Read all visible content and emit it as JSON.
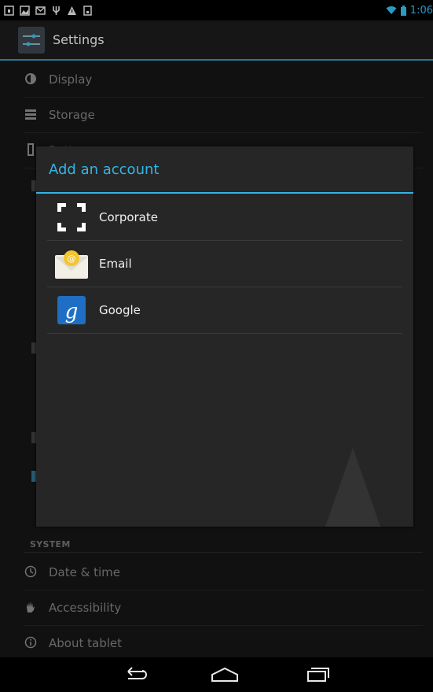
{
  "status_bar": {
    "time": "1:06",
    "left_icons": [
      "tablet-icon",
      "image-icon",
      "mail-icon",
      "usb-icon",
      "warning-icon",
      "download-icon"
    ],
    "right_icons": [
      "wifi-icon",
      "battery-icon"
    ],
    "accent_color": "#33b5e5"
  },
  "action_bar": {
    "title": "Settings",
    "icon": "settings-sliders-icon"
  },
  "settings": {
    "items": [
      {
        "label": "Display",
        "icon": "brightness-icon"
      },
      {
        "label": "Storage",
        "icon": "storage-icon"
      },
      {
        "label": "Battery",
        "icon": "battery-icon"
      }
    ],
    "system_header": "SYSTEM",
    "system_items": [
      {
        "label": "Date & time",
        "icon": "clock-icon"
      },
      {
        "label": "Accessibility",
        "icon": "hand-icon"
      },
      {
        "label": "About tablet",
        "icon": "info-icon"
      }
    ]
  },
  "dialog": {
    "title": "Add an account",
    "accounts": [
      {
        "label": "Corporate",
        "icon": "corporate-icon"
      },
      {
        "label": "Email",
        "icon": "email-icon"
      },
      {
        "label": "Google",
        "icon": "google-icon"
      }
    ]
  },
  "nav_bar": {
    "buttons": [
      "back-icon",
      "home-icon",
      "recent-apps-icon"
    ]
  }
}
